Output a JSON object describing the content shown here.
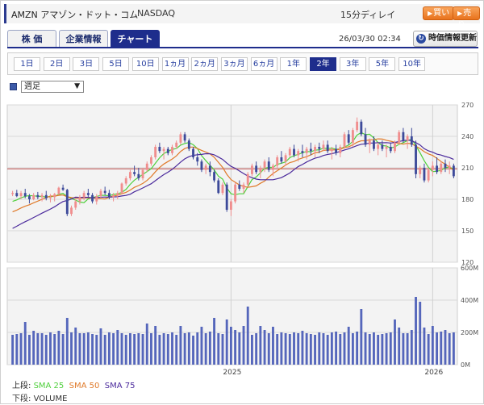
{
  "header": {
    "title": "AMZN アマゾン・ドット・コム",
    "exchange": "NASDAQ",
    "delay": "15分ディレイ",
    "buy_label": "買い",
    "sell_label": "売り"
  },
  "tabs": [
    {
      "label": "株 価",
      "active": false
    },
    {
      "label": "企業情報",
      "active": false
    },
    {
      "label": "チャート",
      "active": true
    }
  ],
  "datetime": "26/03/30 02:34",
  "refresh_label": "時価情報更新",
  "periods": [
    {
      "label": "1日",
      "active": false
    },
    {
      "label": "2日",
      "active": false
    },
    {
      "label": "3日",
      "active": false
    },
    {
      "label": "5日",
      "active": false
    },
    {
      "label": "10日",
      "active": false
    },
    {
      "label": "1ヵ月",
      "active": false
    },
    {
      "label": "2ヵ月",
      "active": false
    },
    {
      "label": "3ヵ月",
      "active": false
    },
    {
      "label": "6ヵ月",
      "active": false
    },
    {
      "label": "1年",
      "active": false
    },
    {
      "label": "2年",
      "active": true
    },
    {
      "label": "3年",
      "active": false
    },
    {
      "label": "5年",
      "active": false
    },
    {
      "label": "10年",
      "active": false
    }
  ],
  "interval_select": "週足",
  "legend": {
    "upper_label": "上段:",
    "lower_label": "下段:",
    "sma25": "SMA 25",
    "sma50": "SMA 50",
    "sma75": "SMA 75",
    "volume": "VOLUME"
  },
  "colors": {
    "navy": "#1e2d8c",
    "candle_up": "#f08e8e",
    "candle_down": "#3d4a9a",
    "sma25": "#4fcf3c",
    "sma50": "#e07a2a",
    "sma75": "#4b2a9c",
    "hline": "#c0504d",
    "volume": "#5566bb"
  },
  "chart_data": [
    {
      "type": "candlestick",
      "title": "",
      "y_ticks": [
        120,
        150,
        180,
        210,
        240,
        270
      ],
      "ylim": [
        120,
        270
      ],
      "x_ticks": [
        "2025",
        "2026"
      ],
      "reference_price": 209,
      "grid": true,
      "ohlc": [
        [
          185,
          188,
          183,
          186
        ],
        [
          186,
          189,
          182,
          183
        ],
        [
          183,
          188,
          180,
          186
        ],
        [
          186,
          190,
          181,
          183
        ],
        [
          183,
          185,
          176,
          180
        ],
        [
          180,
          186,
          179,
          184
        ],
        [
          184,
          187,
          180,
          182
        ],
        [
          182,
          186,
          178,
          184
        ],
        [
          184,
          188,
          179,
          181
        ],
        [
          181,
          185,
          177,
          182
        ],
        [
          182,
          186,
          178,
          185
        ],
        [
          185,
          192,
          184,
          191
        ],
        [
          191,
          194,
          188,
          189
        ],
        [
          189,
          190,
          164,
          166
        ],
        [
          166,
          174,
          164,
          172
        ],
        [
          172,
          180,
          170,
          178
        ],
        [
          178,
          184,
          175,
          182
        ],
        [
          182,
          188,
          179,
          186
        ],
        [
          186,
          190,
          182,
          184
        ],
        [
          184,
          186,
          176,
          178
        ],
        [
          178,
          185,
          175,
          183
        ],
        [
          183,
          190,
          181,
          188
        ],
        [
          188,
          192,
          184,
          186
        ],
        [
          186,
          189,
          180,
          182
        ],
        [
          182,
          186,
          178,
          184
        ],
        [
          184,
          188,
          180,
          186
        ],
        [
          186,
          196,
          185,
          195
        ],
        [
          195,
          202,
          193,
          200
        ],
        [
          200,
          208,
          198,
          206
        ],
        [
          206,
          212,
          202,
          204
        ],
        [
          204,
          210,
          198,
          200
        ],
        [
          200,
          210,
          198,
          208
        ],
        [
          208,
          216,
          206,
          214
        ],
        [
          214,
          222,
          212,
          220
        ],
        [
          220,
          232,
          218,
          230
        ],
        [
          230,
          234,
          224,
          226
        ],
        [
          226,
          230,
          218,
          228
        ],
        [
          228,
          230,
          222,
          224
        ],
        [
          224,
          232,
          222,
          230
        ],
        [
          230,
          236,
          228,
          234
        ],
        [
          234,
          244,
          232,
          242
        ],
        [
          242,
          244,
          234,
          236
        ],
        [
          236,
          238,
          226,
          228
        ],
        [
          228,
          230,
          218,
          220
        ],
        [
          220,
          224,
          212,
          216
        ],
        [
          216,
          218,
          206,
          208
        ],
        [
          208,
          214,
          204,
          212
        ],
        [
          212,
          216,
          202,
          206
        ],
        [
          206,
          208,
          196,
          198
        ],
        [
          198,
          200,
          185,
          186
        ],
        [
          186,
          196,
          184,
          194
        ],
        [
          194,
          196,
          168,
          170
        ],
        [
          170,
          180,
          164,
          178
        ],
        [
          178,
          196,
          176,
          194
        ],
        [
          194,
          198,
          188,
          190
        ],
        [
          190,
          196,
          186,
          194
        ],
        [
          194,
          206,
          192,
          204
        ],
        [
          204,
          214,
          202,
          212
        ],
        [
          212,
          216,
          204,
          206
        ],
        [
          206,
          212,
          200,
          210
        ],
        [
          210,
          218,
          206,
          216
        ],
        [
          216,
          220,
          206,
          208
        ],
        [
          208,
          214,
          202,
          212
        ],
        [
          212,
          222,
          210,
          220
        ],
        [
          220,
          226,
          214,
          216
        ],
        [
          216,
          224,
          212,
          222
        ],
        [
          222,
          230,
          220,
          228
        ],
        [
          228,
          232,
          220,
          222
        ],
        [
          222,
          228,
          216,
          226
        ],
        [
          226,
          232,
          220,
          224
        ],
        [
          224,
          230,
          218,
          228
        ],
        [
          228,
          234,
          222,
          226
        ],
        [
          226,
          232,
          220,
          230
        ],
        [
          230,
          234,
          224,
          228
        ],
        [
          228,
          236,
          226,
          232
        ],
        [
          232,
          236,
          224,
          226
        ],
        [
          226,
          230,
          218,
          228
        ],
        [
          228,
          232,
          222,
          224
        ],
        [
          224,
          232,
          220,
          230
        ],
        [
          230,
          244,
          228,
          242
        ],
        [
          242,
          246,
          232,
          234
        ],
        [
          234,
          248,
          230,
          246
        ],
        [
          246,
          258,
          244,
          254
        ],
        [
          254,
          256,
          240,
          242
        ],
        [
          242,
          248,
          230,
          232
        ],
        [
          232,
          238,
          224,
          236
        ],
        [
          236,
          240,
          226,
          228
        ],
        [
          228,
          234,
          222,
          232
        ],
        [
          232,
          236,
          226,
          228
        ],
        [
          228,
          232,
          220,
          230
        ],
        [
          230,
          234,
          224,
          226
        ],
        [
          226,
          236,
          224,
          234
        ],
        [
          234,
          246,
          232,
          244
        ],
        [
          244,
          248,
          234,
          236
        ],
        [
          236,
          242,
          228,
          240
        ],
        [
          240,
          248,
          230,
          232
        ],
        [
          232,
          236,
          200,
          204
        ],
        [
          204,
          212,
          200,
          210
        ],
        [
          210,
          214,
          196,
          198
        ],
        [
          198,
          210,
          196,
          208
        ],
        [
          208,
          216,
          202,
          212
        ],
        [
          212,
          220,
          204,
          206
        ],
        [
          206,
          216,
          204,
          214
        ],
        [
          214,
          218,
          206,
          210
        ],
        [
          210,
          216,
          204,
          212
        ],
        [
          212,
          214,
          200,
          202
        ]
      ],
      "volume_ylim": [
        0,
        600
      ],
      "volume_ticks": [
        0,
        200,
        400,
        600
      ],
      "volume_tick_labels": [
        "0M",
        "200M",
        "400M",
        "600M"
      ],
      "volume": [
        185,
        190,
        195,
        265,
        185,
        210,
        195,
        195,
        185,
        200,
        190,
        210,
        190,
        290,
        200,
        230,
        195,
        195,
        200,
        190,
        185,
        225,
        185,
        200,
        195,
        215,
        195,
        185,
        195,
        190,
        195,
        190,
        255,
        195,
        240,
        185,
        195,
        190,
        200,
        185,
        240,
        195,
        200,
        180,
        200,
        235,
        195,
        205,
        290,
        195,
        190,
        280,
        235,
        215,
        200,
        240,
        360,
        185,
        195,
        240,
        215,
        195,
        235,
        190,
        200,
        195,
        190,
        200,
        195,
        210,
        195,
        190,
        185,
        200,
        195,
        185,
        200,
        205,
        190,
        200,
        235,
        195,
        205,
        345,
        200,
        190,
        200,
        185,
        190,
        195,
        200,
        280,
        230,
        195,
        195,
        215,
        420,
        390,
        230,
        190,
        240,
        200,
        205,
        215,
        195,
        200
      ]
    }
  ]
}
